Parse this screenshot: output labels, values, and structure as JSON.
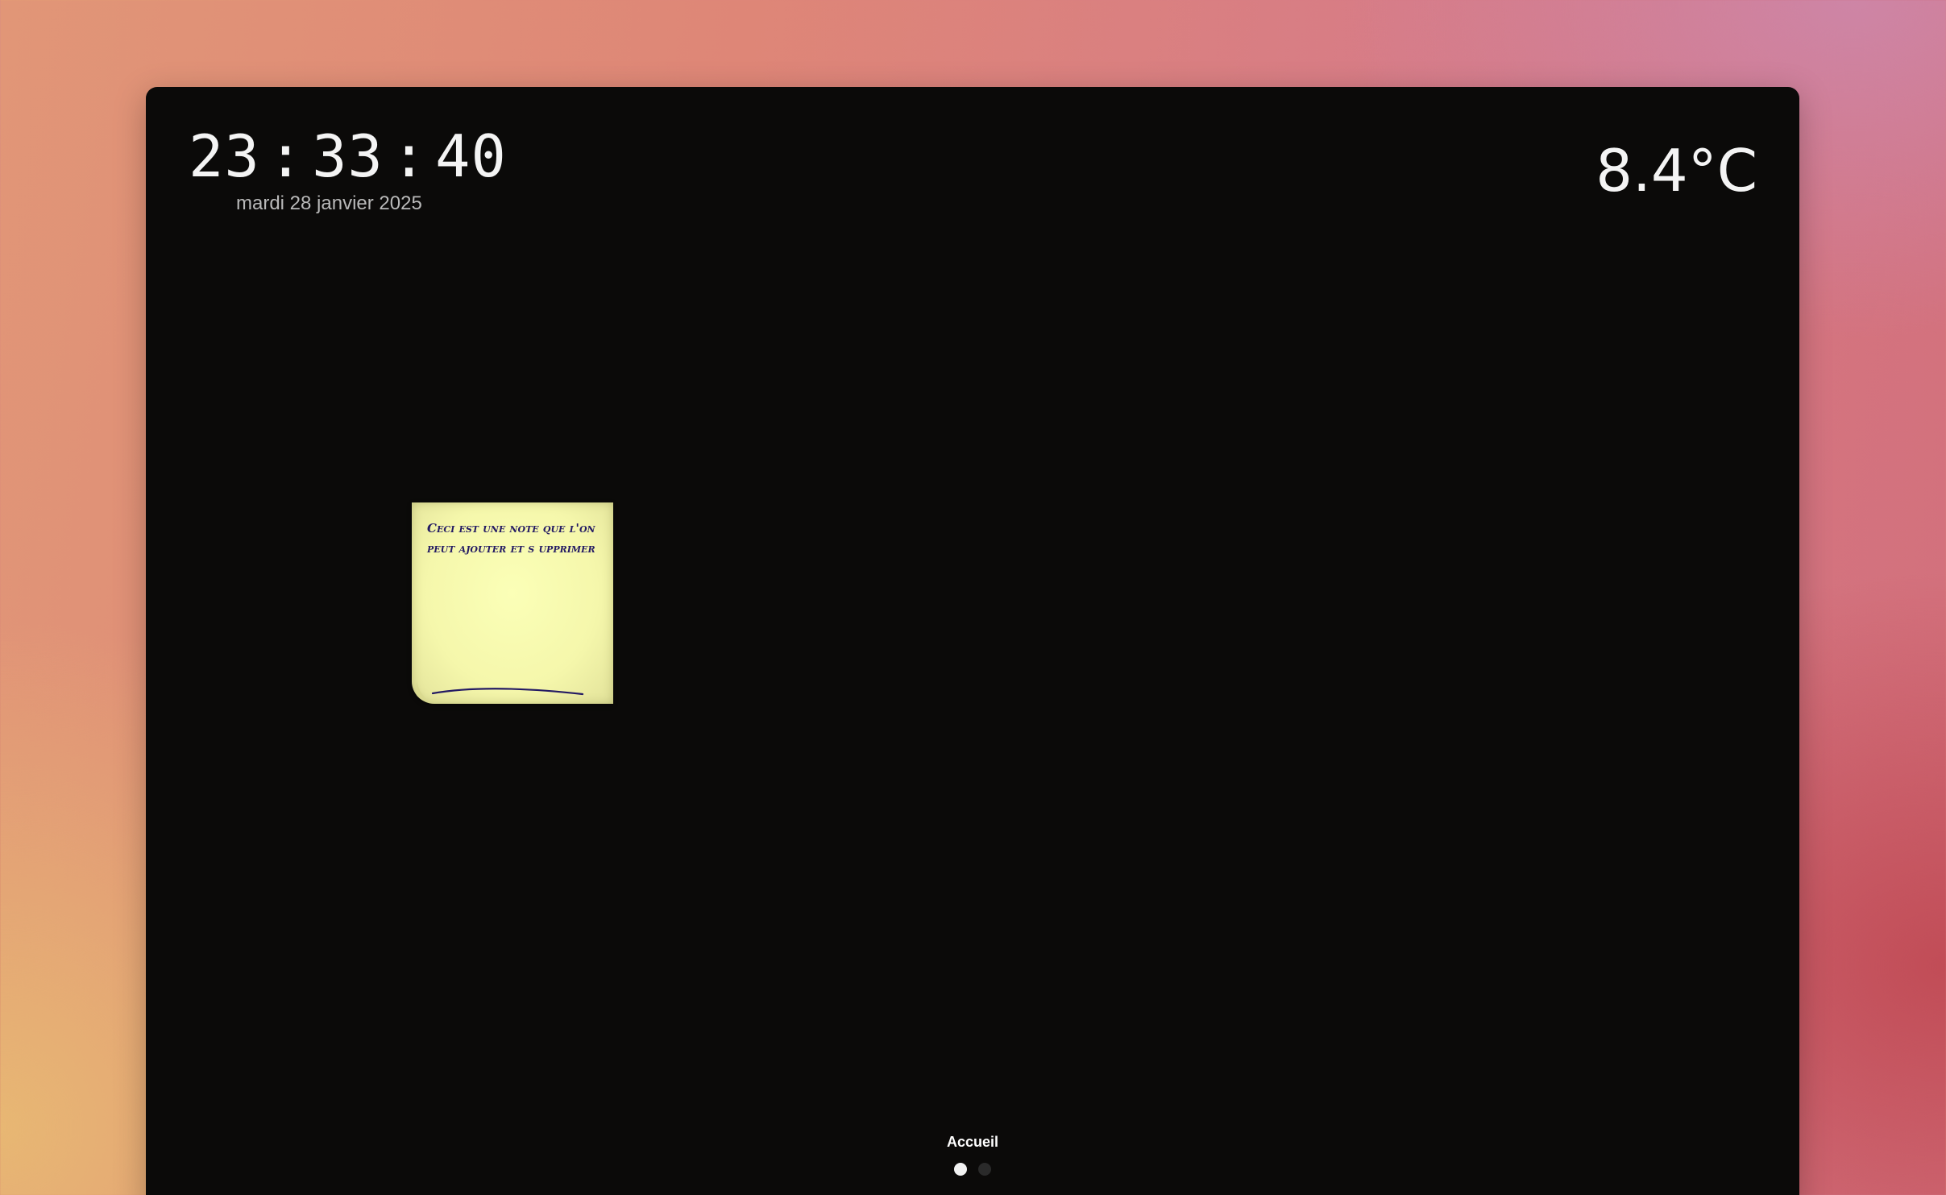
{
  "clock": {
    "hours": "23",
    "minutes": "33",
    "seconds": "40",
    "separator": ":",
    "date": "mardi 28 janvier 2025"
  },
  "weather": {
    "temperature": "8.4°C"
  },
  "note": {
    "text": "Ceci est une note que l'on peut ajouter et s upprimer",
    "ink_color": "#231a63",
    "paper_color": "#f8fbb2"
  },
  "navigation": {
    "page_title": "Accueil",
    "pages": [
      {
        "active": true
      },
      {
        "active": false
      }
    ]
  },
  "colors": {
    "screen_background": "#0b0a09",
    "text_primary": "#f4f4f4",
    "text_secondary": "#b9b9b9"
  }
}
